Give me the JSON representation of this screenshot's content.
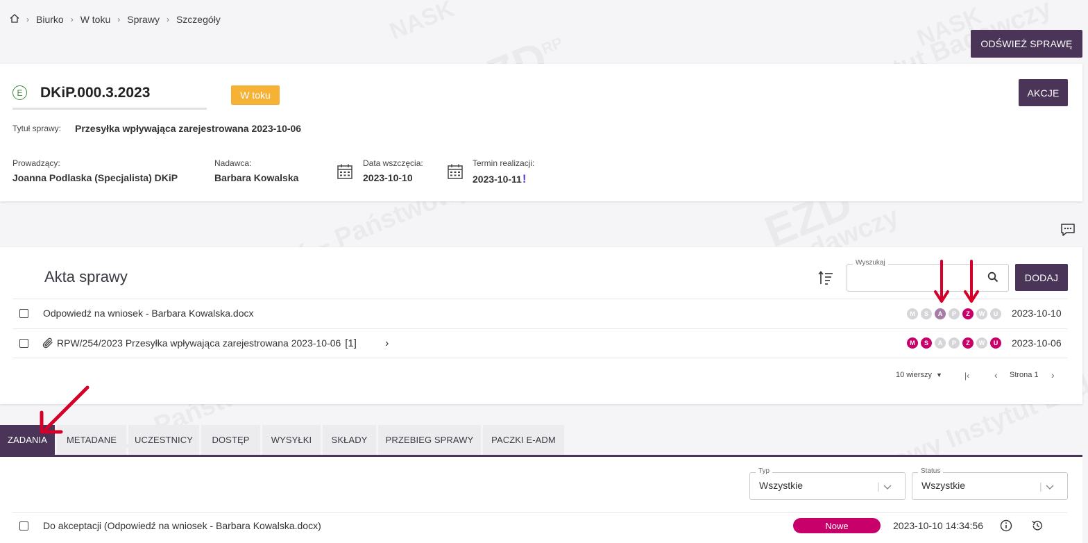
{
  "breadcrumb": {
    "items": [
      "Biurko",
      "W toku",
      "Sprawy",
      "Szczegóły"
    ]
  },
  "header": {
    "refresh_button": "ODŚWIEŻ SPRAWĘ"
  },
  "case": {
    "signature": "DKiP.000.3.2023",
    "type_letter": "E",
    "status": "W toku",
    "actions_button": "AKCJE",
    "title_label": "Tytuł sprawy:",
    "title": "Przesyłka wpływająca zarejestrowana 2023-10-06",
    "owner_label": "Prowadzący:",
    "owner": "Joanna Podlaska (Specjalista) DKiP",
    "sender_label": "Nadawca:",
    "sender": "Barbara Kowalska",
    "start_label": "Data wszczęcia:",
    "start_date": "2023-10-10",
    "deadline_label": "Termin realizacji:",
    "deadline_date": "2023-10-11",
    "deadline_mark": "!"
  },
  "akta": {
    "title": "Akta sprawy",
    "search_label": "Wyszukaj",
    "add_button": "DODAJ",
    "rows": [
      {
        "name": "Odpowiedź na wniosek - Barbara Kowalska.docx",
        "date": "2023-10-10",
        "flags": [
          [
            "M",
            "g"
          ],
          [
            "S",
            "g"
          ],
          [
            "A",
            "v"
          ],
          [
            "P",
            "g"
          ],
          [
            "Z",
            "m"
          ],
          [
            "W",
            "g"
          ],
          [
            "U",
            "g"
          ]
        ]
      },
      {
        "name": "RPW/254/2023 Przesyłka wpływająca zarejestrowana 2023-10-06",
        "count": "[1]",
        "date": "2023-10-06",
        "flags": [
          [
            "M",
            "m"
          ],
          [
            "S",
            "m"
          ],
          [
            "A",
            "g"
          ],
          [
            "P",
            "g"
          ],
          [
            "Z",
            "m"
          ],
          [
            "W",
            "g"
          ],
          [
            "U",
            "m"
          ]
        ]
      }
    ],
    "rows_per_page": "10 wierszy",
    "page": "Strona 1"
  },
  "tabs": [
    "ZADANIA",
    "METADANE",
    "UCZESTNICY",
    "DOSTĘP",
    "WYSYŁKI",
    "SKŁADY",
    "PRZEBIEG SPRAWY",
    "PACZKI E-ADM"
  ],
  "tasks": {
    "type_label": "Typ",
    "type_value": "Wszystkie",
    "status_label": "Status",
    "status_value": "Wszystkie",
    "rows": [
      {
        "name": "Do akceptacji (Odpowiedź na wniosek - Barbara Kowalska.docx)",
        "status": "Nowe",
        "datetime": "2023-10-10 14:34:56"
      }
    ]
  },
  "watermark": {
    "brand": "EZD",
    "brand_sup": "RP",
    "org": "NASK",
    "text": "NASK – Państwowy Instytut Badawczy"
  },
  "colors": {
    "primary": "#4a3458",
    "accent": "#c8006a",
    "warning": "#f6b235",
    "arrow": "#d4002a"
  }
}
